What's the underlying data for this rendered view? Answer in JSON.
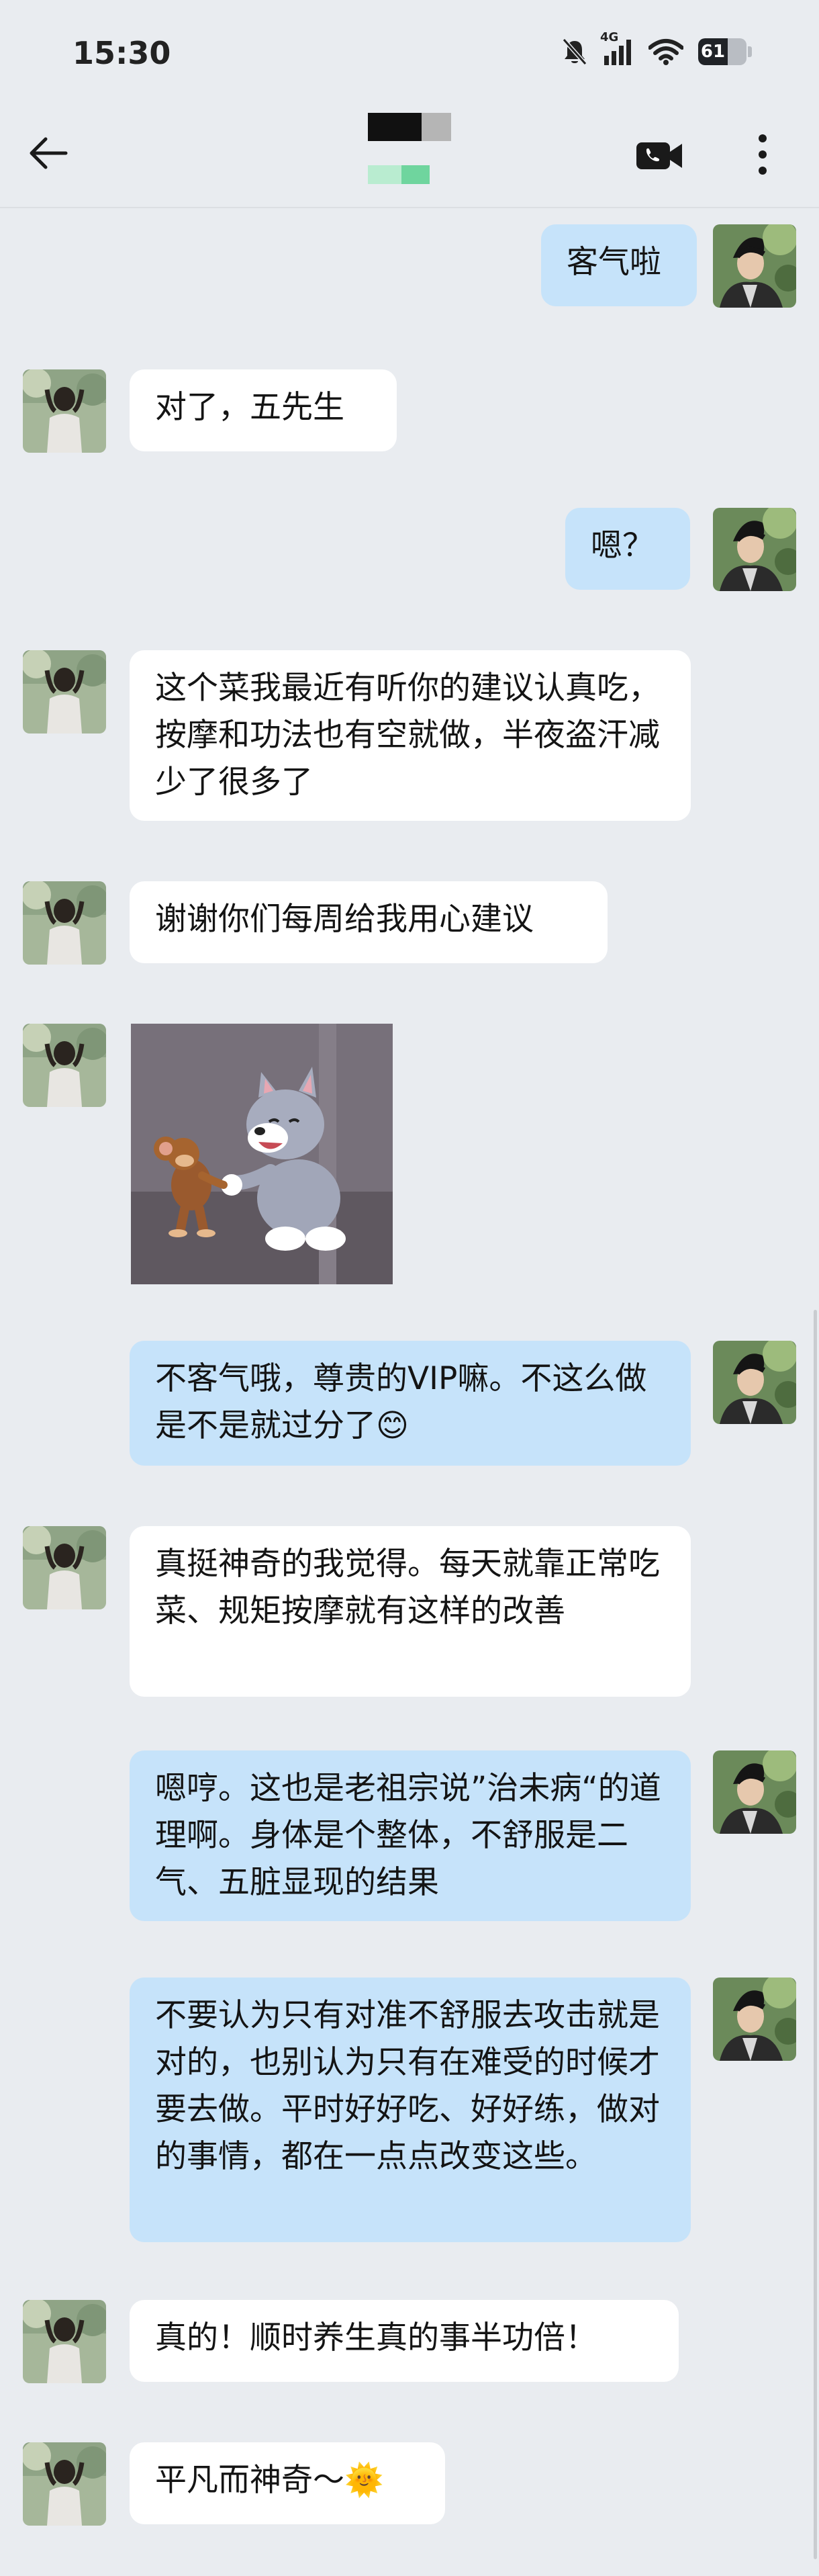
{
  "status_bar": {
    "time": "15:30",
    "network": "4G",
    "battery": "61",
    "battery_percent": 61,
    "icons": [
      "mute-bell-icon",
      "signal-icon",
      "wifi-icon",
      "battery-icon"
    ]
  },
  "header": {
    "icons": [
      "back-arrow-icon",
      "video-call-icon",
      "more-vertical-icon"
    ]
  },
  "messages": [
    {
      "side": "out",
      "text": "客气啦"
    },
    {
      "side": "in",
      "text": "对了，五先生"
    },
    {
      "side": "out",
      "text": "嗯？"
    },
    {
      "side": "in",
      "text": "这个菜我最近有听你的建议认真吃，按摩和功法也有空就做，半夜盗汗减少了很多了"
    },
    {
      "side": "in",
      "text": "谢谢你们每周给我用心建议"
    },
    {
      "side": "in",
      "type": "sticker",
      "icon": "cat-mouse-sticker"
    },
    {
      "side": "out",
      "text": "不客气哦，尊贵的VIP嘛。不这么做是不是就过分了😊"
    },
    {
      "side": "in",
      "text": "真挺神奇的我觉得。每天就靠正常吃菜、规矩按摩就有这样的改善"
    },
    {
      "side": "out",
      "text": "嗯哼。这也是老祖宗说”治未病“的道理啊。身体是个整体，不舒服是二气、五脏显现的结果"
    },
    {
      "side": "out",
      "text": "不要认为只有对准不舒服去攻击就是对的，也别认为只有在难受的时候才要去做。平时好好吃、好好练，做对的事情，都在一点点改变这些。"
    },
    {
      "side": "in",
      "text": "真的！顺时养生真的事半功倍！"
    },
    {
      "side": "in",
      "text": "平凡而神奇～🌞"
    }
  ],
  "colors": {
    "background": "#e9ecf0",
    "incoming_bubble": "#ffffff",
    "outgoing_bubble": "#c6e3fa"
  }
}
